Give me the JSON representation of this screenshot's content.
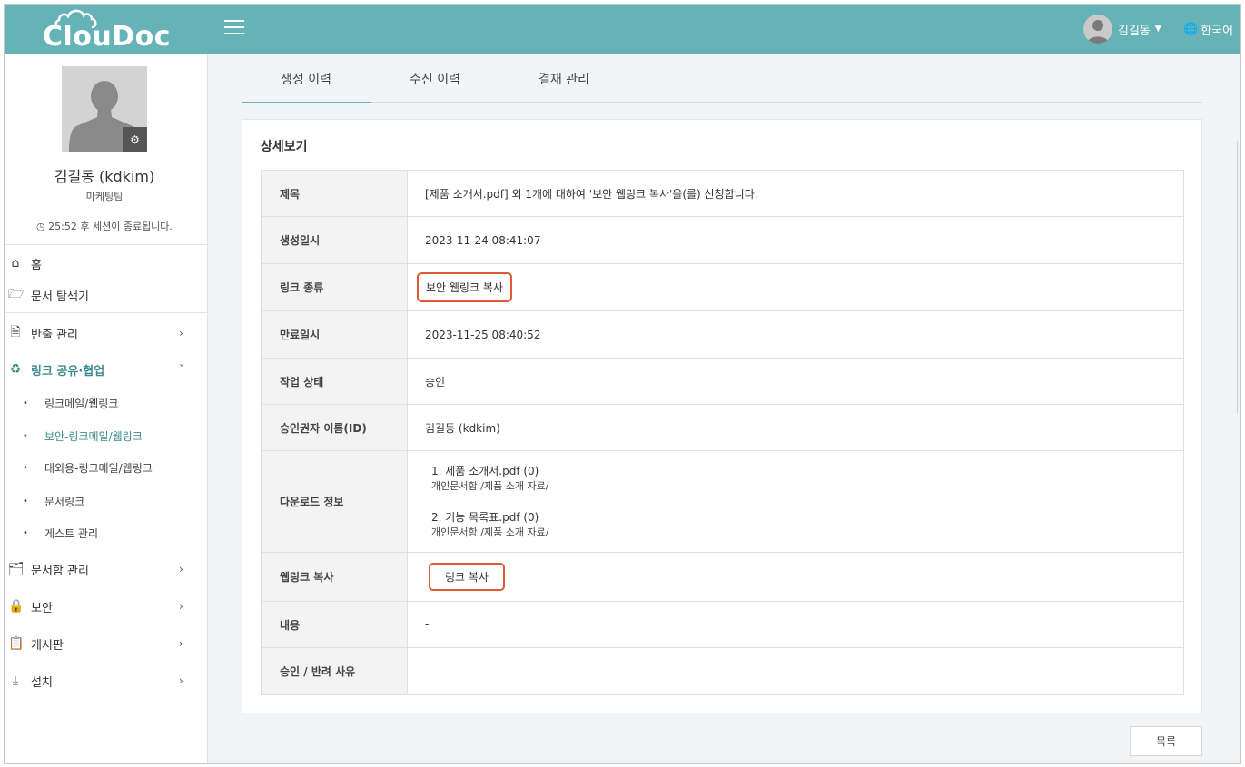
{
  "header": {
    "logo_text": "ClouDoc",
    "user_name": "김길동",
    "language": "한국어"
  },
  "sidebar": {
    "profile_name": "김길동 (kdkim)",
    "team": "마케팅팀",
    "session": "25:52 후 세션이 종료됩니다.",
    "items": [
      {
        "label": "홈"
      },
      {
        "label": "문서 탐색기"
      },
      {
        "label": "반출 관리"
      },
      {
        "label": "링크 공유·협업"
      },
      {
        "label": "문서함 관리"
      },
      {
        "label": "보안"
      },
      {
        "label": "게시판"
      },
      {
        "label": "설치"
      }
    ],
    "sub_items": [
      {
        "label": "링크메일/웹링크"
      },
      {
        "label": "보안-링크메일/웹링크"
      },
      {
        "label": "대외용-링크메일/웹링크"
      },
      {
        "label": "문서링크"
      },
      {
        "label": "게스트 관리"
      }
    ]
  },
  "tabs": [
    {
      "label": "생성 이력"
    },
    {
      "label": "수신 이력"
    },
    {
      "label": "결재 관리"
    }
  ],
  "detail": {
    "section_title": "상세보기",
    "rows": {
      "title": {
        "label": "제목",
        "value": "[제품 소개서.pdf] 외 1개에 대하여 '보안 웹링크 복사'을(를) 신청합니다."
      },
      "created": {
        "label": "생성일시",
        "value": "2023-11-24 08:41:07"
      },
      "link_type": {
        "label": "링크 종류",
        "value": "보안 웹링크 복사"
      },
      "expiry": {
        "label": "만료일시",
        "value": "2023-11-25 08:40:52"
      },
      "status": {
        "label": "작업 상태",
        "value": "승인"
      },
      "approver": {
        "label": "승인권자 이름(ID)",
        "value": "김길동 (kdkim)"
      },
      "download": {
        "label": "다운로드 정보",
        "files": [
          {
            "name": "1. 제품 소개서.pdf (0)",
            "path": "개인문서함:/제품 소개 자료/"
          },
          {
            "name": "2. 기능 목록표.pdf (0)",
            "path": "개인문서함:/제품 소개 자료/"
          }
        ]
      },
      "weblink_copy": {
        "label": "웹링크 복사",
        "button": "링크 복사"
      },
      "content": {
        "label": "내용",
        "value": "-"
      },
      "reason": {
        "label": "승인 / 반려 사유",
        "value": ""
      }
    }
  },
  "footer": {
    "list_button": "목록"
  },
  "colors": {
    "header_bg": "#66b3b7",
    "accent": "#3f8a8e",
    "highlight_border": "#e25a33",
    "status_approved": "#d24a3a"
  }
}
